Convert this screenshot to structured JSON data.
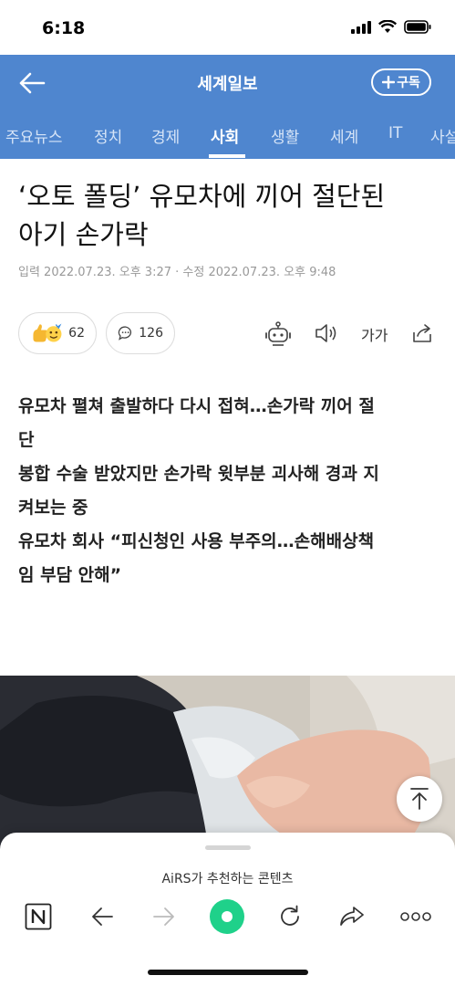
{
  "status": {
    "time": "6:18"
  },
  "header": {
    "title": "세계일보",
    "subscribe_label": "구독"
  },
  "tabs": [
    "주요뉴스",
    "정치",
    "경제",
    "사회",
    "생활",
    "세계",
    "IT",
    "사설"
  ],
  "active_tab": "사회",
  "article": {
    "headline_line1": "‘오토 폴딩’ 유모차에 끼어 절단된",
    "headline_line2": "아기 손가락",
    "meta": "입력 2022.07.23. 오후 3:27 · 수정 2022.07.23. 오후 9:48",
    "reaction_count": "62",
    "comment_count": "126",
    "font_size_label": "가가",
    "summary_lines": [
      "유모차 펼쳐 출발하다 다시 접혀…손가락 끼어 절",
      "단",
      "봉합 수술 받았지만 손가락 윗부분 괴사해 경과 지",
      "켜보는 중",
      "유모차 회사 “피신청인 사용 부주의…손해배상책",
      "임 부담 안해”"
    ]
  },
  "bottom_sheet": {
    "title": "AiRS가 추천하는 콘텐츠"
  },
  "colors": {
    "header_bg": "#4f86cf",
    "accent_green": "#1fd18a"
  }
}
